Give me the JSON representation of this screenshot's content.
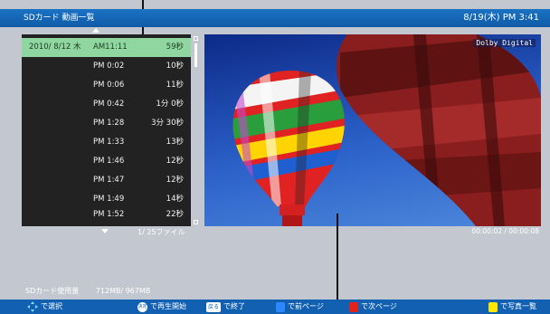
{
  "header": {
    "title": "SDカード 動画一覧",
    "datetime": "8/19(木) PM  3:41"
  },
  "list": {
    "items": [
      {
        "date": "2010/ 8/12  木",
        "time": "AM11:11",
        "duration": "59秒",
        "selected": true
      },
      {
        "date": "",
        "time": "PM 0:02",
        "duration": "10秒",
        "selected": false
      },
      {
        "date": "",
        "time": "PM 0:06",
        "duration": "11秒",
        "selected": false
      },
      {
        "date": "",
        "time": "PM 0:42",
        "duration": "1分  0秒",
        "selected": false
      },
      {
        "date": "",
        "time": "PM 1:28",
        "duration": "3分 30秒",
        "selected": false
      },
      {
        "date": "",
        "time": "PM 1:33",
        "duration": "13秒",
        "selected": false
      },
      {
        "date": "",
        "time": "PM 1:46",
        "duration": "12秒",
        "selected": false
      },
      {
        "date": "",
        "time": "PM 1:47",
        "duration": "12秒",
        "selected": false
      },
      {
        "date": "",
        "time": "PM 1:49",
        "duration": "14秒",
        "selected": false
      },
      {
        "date": "",
        "time": "PM 1:52",
        "duration": "22秒",
        "selected": false
      }
    ],
    "file_count": "1/  25ファイル"
  },
  "video": {
    "audio_badge": "Dolby Digital",
    "timecode": "00:00:02 / 00:00:08"
  },
  "storage": {
    "label": "SDカード使用量",
    "value": "712MB/  967MB"
  },
  "footer": {
    "select": "で選択",
    "play_key": "決定",
    "play": "で再生開始",
    "back_key": "戻る",
    "back": "で終了",
    "prev": "で前ページ",
    "next": "で次ページ",
    "photo_key": "黄",
    "photo": "で写真一覧"
  },
  "colors": {
    "header": "#1160b2",
    "selected_row": "#8fd6a1",
    "blue_key": "#2c88ff",
    "red_key": "#e0231b",
    "yellow_key": "#ffe600"
  }
}
